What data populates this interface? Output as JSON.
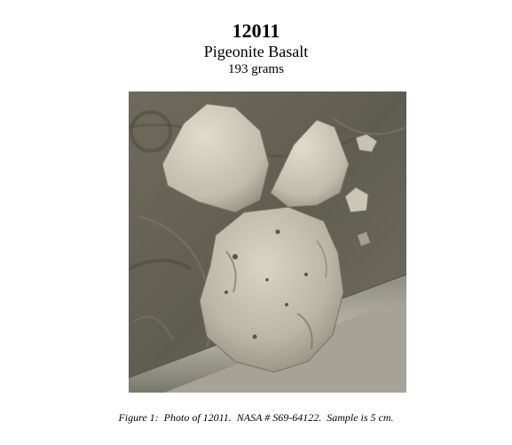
{
  "header": {
    "sample_id": "12011",
    "rock_type": "Pigeonite Basalt",
    "mass": "193 grams"
  },
  "figure": {
    "caption": "Figure 1:  Photo of 12011.  NASA # S69-64122.  Sample is 5 cm."
  }
}
